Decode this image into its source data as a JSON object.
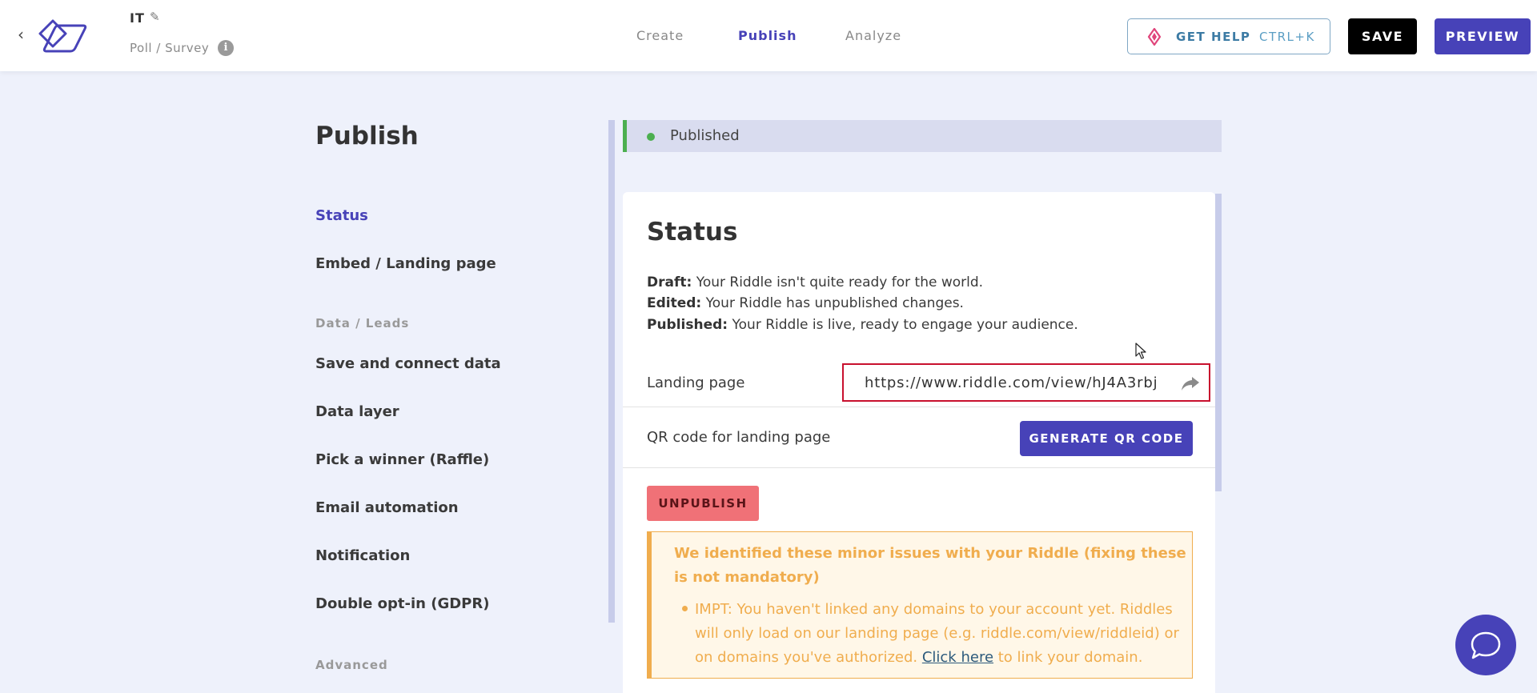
{
  "header": {
    "back_glyph": "‹",
    "title": "IT",
    "subtitle": "Poll / Survey",
    "info_glyph": "i",
    "tabs": [
      {
        "label": "Create",
        "active": false
      },
      {
        "label": "Publish",
        "active": true
      },
      {
        "label": "Analyze",
        "active": false
      }
    ],
    "help_label": "GET HELP",
    "help_shortcut": "CTRL+K",
    "save_label": "SAVE",
    "preview_label": "PREVIEW"
  },
  "sidebar": {
    "title": "Publish",
    "items": [
      {
        "label": "Status",
        "active": true
      },
      {
        "label": "Embed / Landing page"
      },
      {
        "label": "Save and connect data"
      },
      {
        "label": "Data layer"
      },
      {
        "label": "Pick a winner (Raffle)"
      },
      {
        "label": "Email automation"
      },
      {
        "label": "Notification"
      },
      {
        "label": "Double opt-in (GDPR)"
      }
    ],
    "sections": {
      "data_leads": "Data / Leads",
      "advanced": "Advanced"
    }
  },
  "status_bar": {
    "text": "Published",
    "color": "#4caf50"
  },
  "card": {
    "title": "Status",
    "descriptions": [
      {
        "term": "Draft:",
        "text": " Your Riddle isn't quite ready for the world."
      },
      {
        "term": "Edited:",
        "text": " Your Riddle has unpublished changes."
      },
      {
        "term": "Published:",
        "text": " Your Riddle is live, ready to engage your audience."
      }
    ],
    "landing_label": "Landing page",
    "landing_url": "https://www.riddle.com/view/hJ4A3rbj",
    "qr_label": "QR code for landing page",
    "qr_button": "GENERATE QR CODE",
    "unpublish_button": "UNPUBLISH",
    "warning": {
      "title": "We identified these minor issues with your Riddle (fixing these is not mandatory)",
      "text_before": "IMPT: You haven't linked any domains to your account yet. Riddles will only load on our landing page (e.g. riddle.com/view/riddleid) or on domains you've authorized. ",
      "link": "Click here",
      "text_after": " to link your domain."
    }
  },
  "colors": {
    "accent": "#4742b8",
    "warning": "#f0ad4e",
    "danger": "#f07177"
  }
}
